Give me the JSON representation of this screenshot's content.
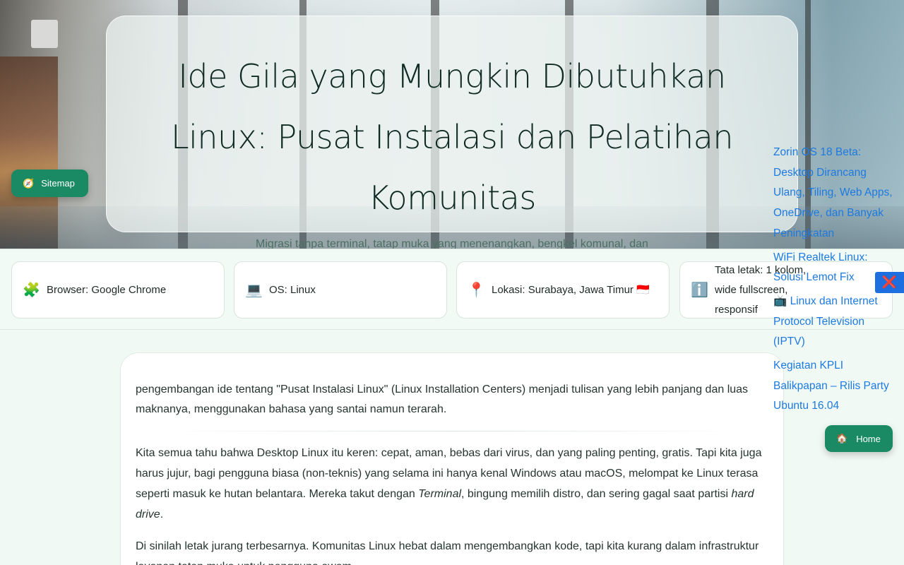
{
  "hero": {
    "title": "Ide Gila yang Mungkin Dibutuhkan Linux: Pusat Instalasi dan Pelatihan Komunitas",
    "subtitle": "Migrasi tanpa terminal, tatap muka yang menenangkan, bengkel komunal, dan workshop santai—Linux untuk semua."
  },
  "buttons": {
    "sitemap_icon": "🧭",
    "sitemap_label": "Sitemap",
    "home_icon": "🏠",
    "home_label": "Home",
    "close_icon": "❌"
  },
  "info_cards": [
    {
      "icon": "🧩",
      "text": "Browser: Google Chrome"
    },
    {
      "icon": "💻",
      "text": "OS: Linux"
    },
    {
      "icon": "📍",
      "text": "Lokasi: Surabaya, Jawa Timur 🇮🇩"
    },
    {
      "icon": "ℹ️",
      "text": "Tata letak: 1 kolom, wide fullscreen, responsif"
    }
  ],
  "side_links": [
    "Zorin OS 18 Beta: Desktop Dirancang Ulang, Tiling, Web Apps, OneDrive, dan Banyak Peningkatan",
    "WiFi Realtek Linux: Solusi Lemot Fix",
    "📺 Linux dan Internet Protocol Television (IPTV)",
    "Kegiatan KPLI Balikpapan – Rilis Party Ubuntu 16.04"
  ],
  "article": {
    "intro": " pengembangan ide tentang \"Pusat Instalasi Linux\" (Linux Installation Centers) menjadi tulisan yang lebih panjang dan luas maknanya, menggunakan bahasa yang santai namun terarah.",
    "p1_a": "Kita semua tahu bahwa Desktop Linux itu keren: cepat, aman, bebas dari virus, dan yang paling penting, gratis. Tapi kita juga harus jujur, bagi pengguna biasa (non-teknis) yang selama ini hanya kenal Windows atau macOS, melompat ke Linux terasa seperti masuk ke hutan belantara. Mereka takut dengan ",
    "p1_em1": "Terminal",
    "p1_b": ", bingung memilih distro, dan sering gagal saat partisi ",
    "p1_em2": "hard drive",
    "p1_c": ".",
    "p2": "Di sinilah letak jurang terbesarnya. Komunitas Linux hebat dalam mengembangkan kode, tapi kita kurang dalam infrastruktur layanan tatap muka untuk pengguna awam."
  }
}
